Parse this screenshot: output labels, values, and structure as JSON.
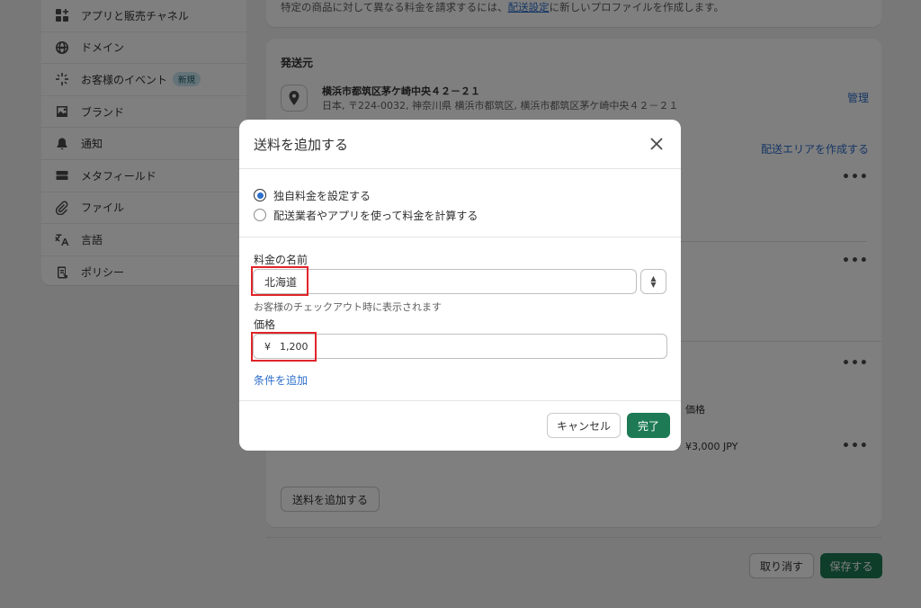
{
  "sidebar": {
    "items": [
      {
        "label": "アプリと販売チャネル",
        "icon": "apps-icon"
      },
      {
        "label": "ドメイン",
        "icon": "globe-icon"
      },
      {
        "label": "お客様のイベント",
        "icon": "sparkle-icon",
        "badge": "新規"
      },
      {
        "label": "ブランド",
        "icon": "image-icon"
      },
      {
        "label": "通知",
        "icon": "bell-icon"
      },
      {
        "label": "メタフィールド",
        "icon": "database-icon"
      },
      {
        "label": "ファイル",
        "icon": "paperclip-icon"
      },
      {
        "label": "言語",
        "icon": "translate-icon"
      },
      {
        "label": "ポリシー",
        "icon": "policy-icon"
      }
    ]
  },
  "top_notice": {
    "text_before": "特定の商品に対して異なる料金を請求するには、",
    "link": "配送設定",
    "text_after": "に新しいプロファイルを作成します。"
  },
  "origin": {
    "section_title": "発送元",
    "name": "横浜市都筑区茅ケ崎中央４２－２１",
    "address": "日本, 〒224-0032, 神奈川県 横浜市都筑区, 横浜市都筑区茅ケ崎中央４２－２１",
    "manage_link": "管理"
  },
  "zones": {
    "create_link": "配送エリアを作成する",
    "price_header": "価格",
    "price_value": "¥3,000 JPY",
    "more_label": "•••",
    "add_rate_button": "送料を追加する"
  },
  "page_actions": {
    "cancel": "取り消す",
    "save": "保存する"
  },
  "modal": {
    "title": "送料を追加する",
    "radio_options": [
      {
        "label": "独自料金を設定する",
        "selected": true
      },
      {
        "label": "配送業者やアプリを使って料金を計算する",
        "selected": false
      }
    ],
    "rate_name_label": "料金の名前",
    "rate_name_value": "北海道",
    "rate_name_help": "お客様のチェックアウト時に表示されます",
    "price_label": "価格",
    "currency_symbol": "¥",
    "price_value": "1,200",
    "add_condition_link": "条件を追加",
    "cancel_button": "キャンセル",
    "done_button": "完了"
  },
  "colors": {
    "primary_button": "#1d7a55",
    "link": "#2c6ecb",
    "highlight_box": "#e0242a",
    "overlay": "rgba(0,0,0,0.5)"
  }
}
